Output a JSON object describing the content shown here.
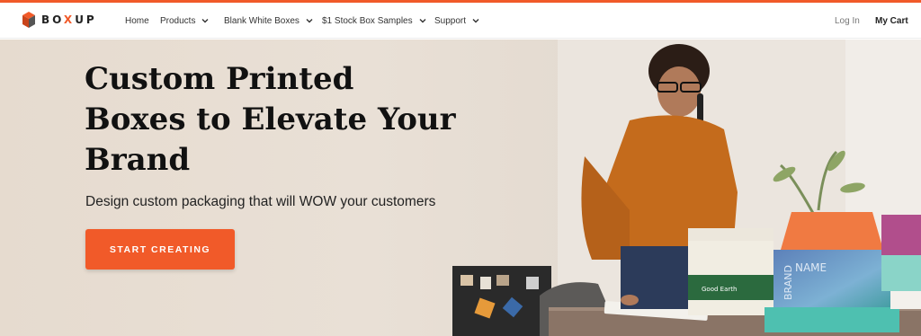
{
  "brand": {
    "name_left": "BO",
    "name_x": "X",
    "name_right": "UP",
    "accent": "#f15a29"
  },
  "nav": {
    "items": [
      {
        "label": "Home",
        "has_dropdown": false
      },
      {
        "label": "Products",
        "has_dropdown": true
      },
      {
        "label": "Blank White Boxes",
        "has_dropdown": true
      },
      {
        "label": "$1 Stock Box Samples",
        "has_dropdown": true
      },
      {
        "label": "Support",
        "has_dropdown": true
      }
    ],
    "login_label": "Log In",
    "cart_label": "My Cart",
    "dropdown_icon": "chevron-down-icon"
  },
  "hero": {
    "title": "Custom Printed Boxes to Elevate Your Brand",
    "subtitle": "Design custom packaging that will WOW your customers",
    "cta_label": "START CREATING",
    "box_texts": {
      "green_box": "Good Earth",
      "blue_box_left": "BRAND",
      "blue_box_right": "NAME"
    }
  }
}
